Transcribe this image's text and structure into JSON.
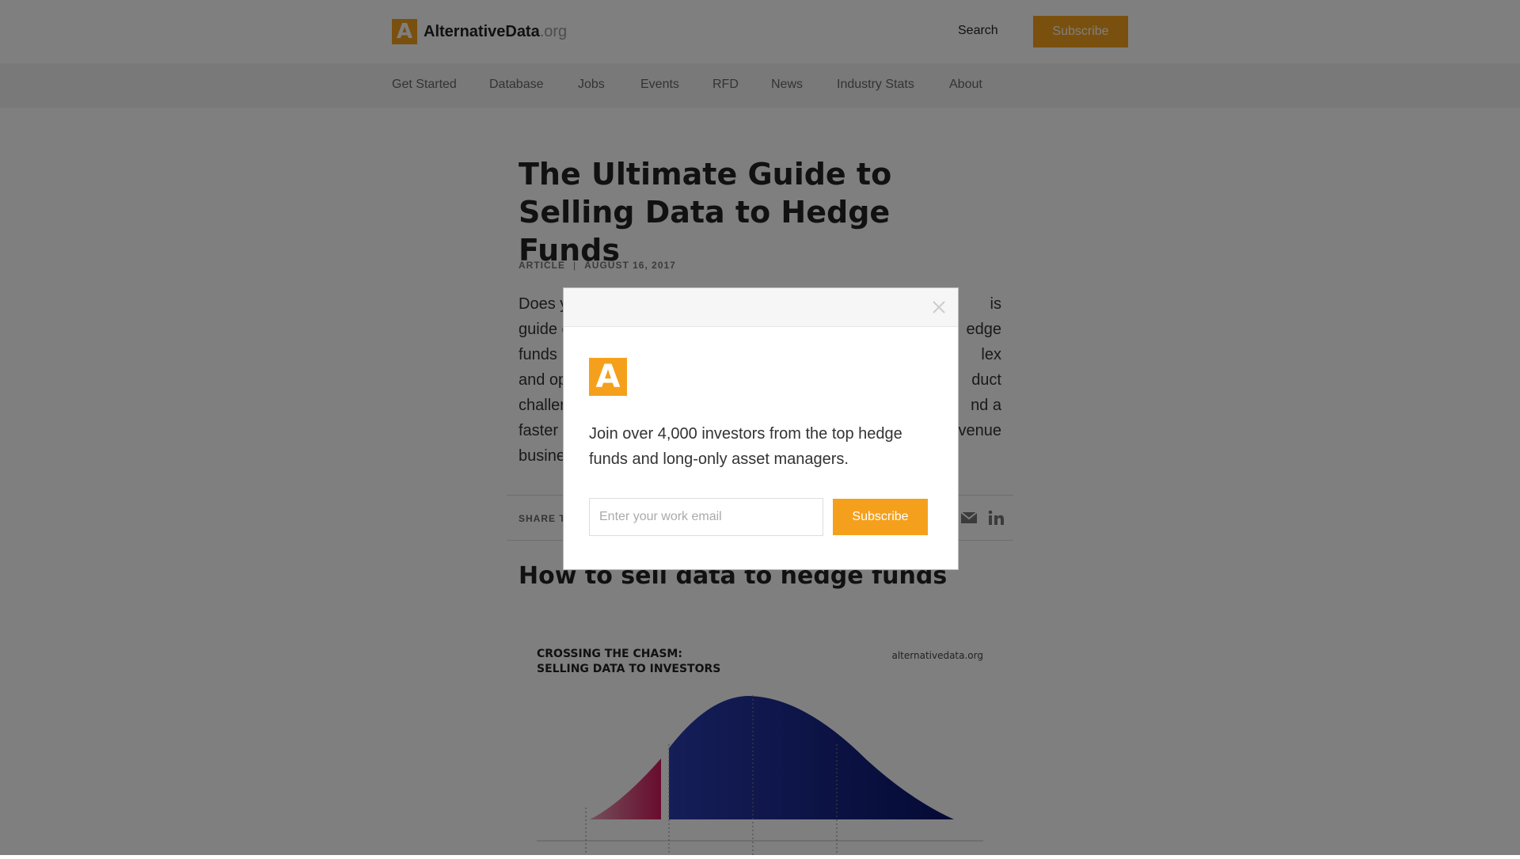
{
  "header": {
    "logo_letter": "A",
    "logo_name": "AlternativeData",
    "logo_tld": ".org",
    "search_label": "Search",
    "subscribe_label": "Subscribe"
  },
  "nav": {
    "items": [
      "Get Started",
      "Database",
      "Jobs",
      "Events",
      "RFD",
      "News",
      "Industry Stats",
      "About"
    ]
  },
  "article": {
    "title": "The Ultimate Guide to Selling Data to Hedge Funds",
    "type": "ARTICLE",
    "date": "AUGUST 16, 2017",
    "intro_lines": [
      "Does y",
      "guide c",
      "funds",
      "and op",
      "challer",
      "faster",
      "busine"
    ],
    "intro_right": [
      "is",
      "edge",
      "lex",
      "duct",
      "nd a",
      "venue",
      ""
    ],
    "share_label": "SHARE T",
    "section_heading": "How to sell data to hedge funds"
  },
  "figure": {
    "title_line1": "CROSSING THE CHASM:",
    "title_line2": "SELLING DATA TO INVESTORS",
    "source": "alternativedata.org"
  },
  "modal": {
    "logo_letter": "A",
    "message": "Join over 4,000 investors from the top hedge funds and long-only asset managers.",
    "email_placeholder": "Enter your work email",
    "subscribe_label": "Subscribe"
  },
  "colors": {
    "accent": "#f5a01c",
    "chart_blue": "#1f2f9a",
    "chart_red": "#d2185a"
  },
  "icons": {
    "close": "close-icon",
    "email": "mail-icon",
    "linkedin": "linkedin-icon"
  }
}
